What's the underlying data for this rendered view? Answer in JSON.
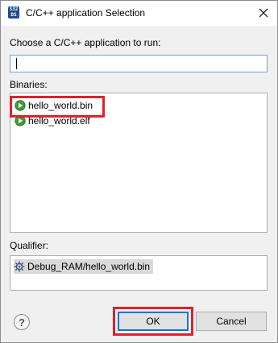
{
  "window": {
    "title": "C/C++ application Selection",
    "app_icon_text": "S32\nDS"
  },
  "prompt": {
    "label": "Choose a C/C++ application to run:",
    "value": ""
  },
  "binaries": {
    "label": "Binaries:",
    "items": [
      {
        "label": "hello_world.bin",
        "icon": "run-icon",
        "selected": true
      },
      {
        "label": "hello_world.elf",
        "icon": "run-icon",
        "selected": false
      }
    ]
  },
  "qualifier": {
    "label": "Qualifier:",
    "items": [
      {
        "label": "Debug_RAM/hello_world.bin",
        "icon": "gear-bug-icon"
      }
    ]
  },
  "buttons": {
    "help": "?",
    "ok": "OK",
    "cancel": "Cancel"
  },
  "colors": {
    "highlight": "#e0202a",
    "accent": "#0078d7",
    "run_icon": "#3c9c3c"
  }
}
